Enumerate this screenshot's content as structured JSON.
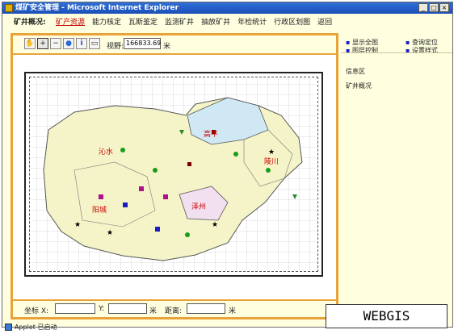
{
  "window": {
    "title": "煤矿安全管理 - Microsoft Internet Explorer",
    "controls": [
      "_",
      "□",
      "×"
    ]
  },
  "menubar": {
    "title": "矿井概况:",
    "items": [
      {
        "label": "矿产资源",
        "active": true
      },
      {
        "label": "能力核定",
        "active": false
      },
      {
        "label": "瓦斯鉴定",
        "active": false
      },
      {
        "label": "监测矿井",
        "active": false
      },
      {
        "label": "抽放矿井",
        "active": false
      },
      {
        "label": "年检统计",
        "active": false
      },
      {
        "label": "行政区划图",
        "active": false
      },
      {
        "label": "返回",
        "active": false
      }
    ]
  },
  "toolbar": {
    "tools": [
      {
        "icon": "pan-hand-icon",
        "glyph": "✋"
      },
      {
        "icon": "zoom-in-icon",
        "glyph": "+"
      },
      {
        "icon": "zoom-out-icon",
        "glyph": "−"
      },
      {
        "icon": "globe-icon",
        "glyph": "●"
      },
      {
        "icon": "info-icon",
        "glyph": "i"
      },
      {
        "icon": "legend-icon",
        "glyph": "▭"
      }
    ],
    "view_label": "视野:",
    "view_value": "166833.69",
    "view_unit": "米"
  },
  "map": {
    "city_labels": [
      {
        "text": "沁水",
        "color": "#cc0000"
      },
      {
        "text": "高平",
        "color": "#cc0000"
      },
      {
        "text": "陵川",
        "color": "#cc0000"
      },
      {
        "text": "阳城",
        "color": "#cc0000"
      },
      {
        "text": "泽州",
        "color": "#cc0000"
      }
    ],
    "colors": {
      "county_fill": "#f4f4c8",
      "border": "#555555",
      "grid": "#cfcfcf",
      "highlight_gaoping": "#cfe8f4",
      "highlight_jincheng": "#f2dff0"
    }
  },
  "coordbar": {
    "x_label": "坐标 X:",
    "y_label": "Y:",
    "unit1": "米",
    "distance_label": "距离:",
    "unit2": "米"
  },
  "rightpanel": {
    "links": [
      {
        "label": "显示全图"
      },
      {
        "label": "查询定位"
      },
      {
        "label": "图层控制"
      },
      {
        "label": "设置样式"
      }
    ],
    "info_title": "信息区",
    "info_text": "矿井概况"
  },
  "statusbar": {
    "text": "Applet 已启动"
  },
  "badge": {
    "text": "WEBGIS"
  }
}
